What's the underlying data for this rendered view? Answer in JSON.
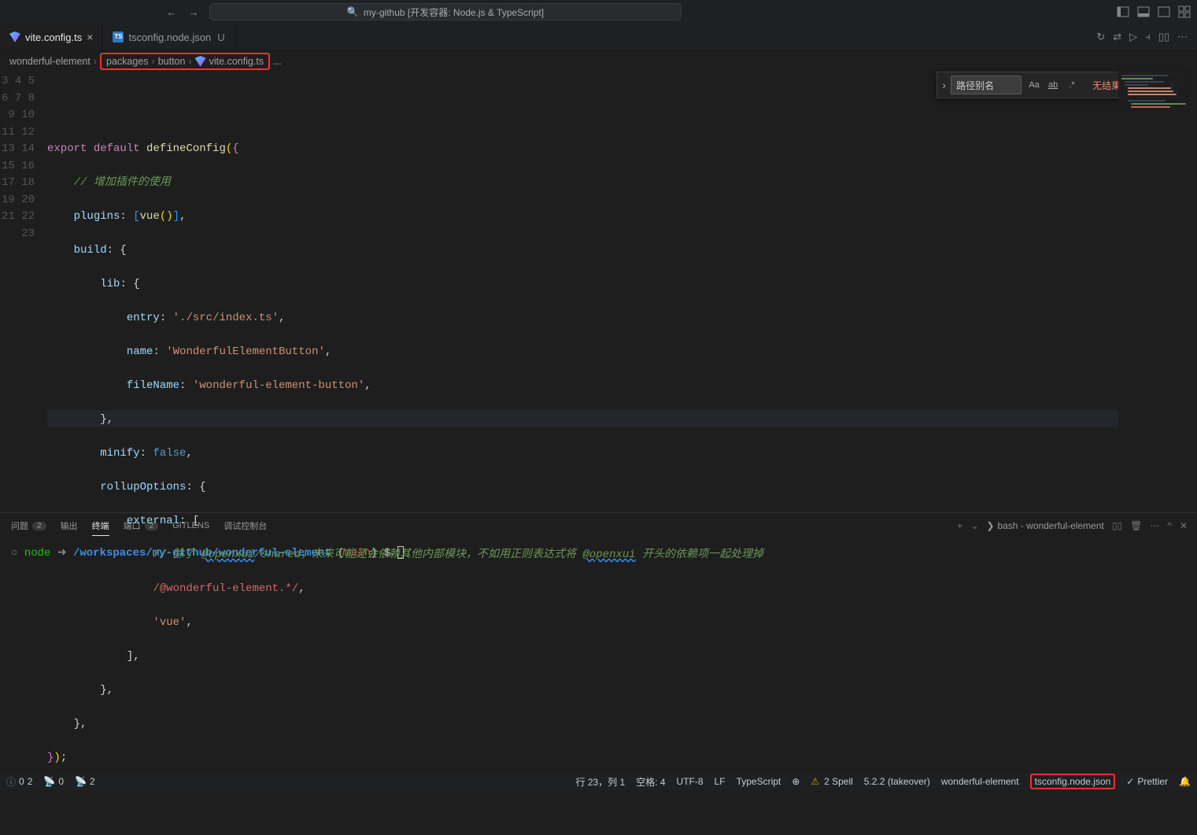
{
  "titlebar": {
    "search_text": "my-github [开发容器: Node.js & TypeScript]"
  },
  "tabs": [
    {
      "label": "vite.config.ts",
      "icon": "vite",
      "active": true,
      "modified": false
    },
    {
      "label": "tsconfig.node.json",
      "icon": "ts",
      "active": false,
      "modified": true,
      "mod_char": "U"
    }
  ],
  "breadcrumb": {
    "root": "wonderful-element",
    "seg1": "packages",
    "seg2": "button",
    "seg3": "vite.config.ts",
    "more": "..."
  },
  "editor": {
    "line_start": 3,
    "line_end": 23,
    "tokens": {
      "l4_export": "export",
      "l4_default": "default",
      "l4_func": "defineConfig",
      "l4_paren": "({",
      "l5_comment": "// 增加插件的使用",
      "l6_key": "plugins",
      "l6_vue": "vue",
      "l6_rest": "()],",
      "l7_key": "build",
      "l7_rest": ": {",
      "l8_key": "lib",
      "l8_rest": ": {",
      "l9_key": "entry",
      "l9_val": "'./src/index.ts'",
      "l10_key": "name",
      "l10_val": "'WonderfulElementButton'",
      "l11_key": "fileName",
      "l11_val": "'wonderful-element-button'",
      "l12": "},",
      "l13_key": "minify",
      "l13_val": "false",
      "l14_key": "rollupOptions",
      "l14_rest": ": {",
      "l15_key": "external",
      "l15_rest": ": [",
      "l16_comment1": "// 除了 ",
      "l16_ref1": "@openxui",
      "l16_comment2": "/shared，未来可能还会依赖其他内部模块，不如用正则表达式将 ",
      "l16_ref2": "@openxui",
      "l16_comment3": " 开头的依赖项一起处理掉",
      "l17_regex": "/@wonderful-element.*/",
      "l18_val": "'vue'",
      "l19": "],",
      "l20": "},",
      "l21": "},",
      "l22": "});"
    }
  },
  "search": {
    "value": "路径别名",
    "opt_case": "Aa",
    "opt_word": "ab",
    "opt_regex": ".*",
    "no_result": "无结果"
  },
  "panel": {
    "tabs": {
      "problems": "问题",
      "problems_count": "2",
      "output": "输出",
      "terminal": "终端",
      "ports": "端口",
      "ports_count": "2",
      "gitlens": "GITLENS",
      "debug": "调试控制台"
    },
    "terminal_label": "bash - wonderful-element"
  },
  "terminal": {
    "host": "node",
    "arrow": "➜",
    "path": "/workspaces/my-github/wonderful-element",
    "branch_open": "(",
    "branch": "main",
    "branch_close": ")",
    "dollar": "$"
  },
  "statusbar": {
    "warn_count": "0",
    "err_count": "2",
    "radio": "0",
    "ports": "2",
    "cursor": "行 23，列 1",
    "spaces": "空格: 4",
    "encoding": "UTF-8",
    "eol": "LF",
    "lang": "TypeScript",
    "spell": "2 Spell",
    "tsver": "5.2.2 (takeover)",
    "tsconfig1": "wonderful-element",
    "tsconfig2": "tsconfig.node.json",
    "prettier": "Prettier"
  }
}
